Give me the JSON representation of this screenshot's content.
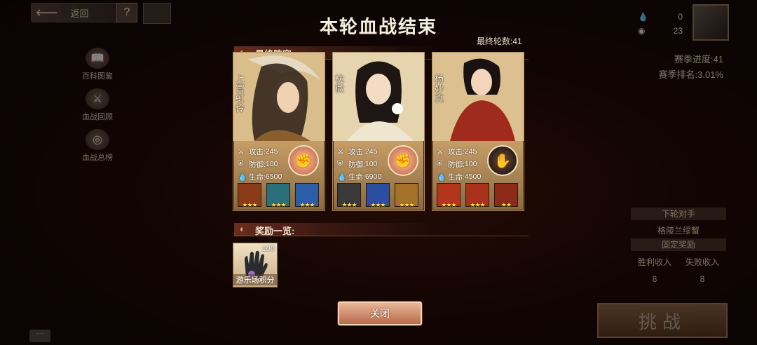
{
  "nav": {
    "back_label": "返回",
    "help_label": "?"
  },
  "side_menu": [
    {
      "label": "百科图鉴",
      "icon": "book-icon"
    },
    {
      "label": "血战回顾",
      "icon": "replay-icon"
    },
    {
      "label": "血战总榜",
      "icon": "ranking-icon"
    }
  ],
  "currency": {
    "top_value": "0",
    "bottom_value": "23"
  },
  "season": {
    "progress": "赛季进度:41",
    "rank": "赛季排名:3.01%"
  },
  "right_panel": {
    "next_opponent_header": "下轮对手",
    "opponent_name": "格陵兰缪蟹",
    "fixed_reward_header": "固定奖励",
    "win_income_label": "胜利收入",
    "lose_income_label": "失败收入",
    "win_value": "8",
    "lose_value": "8",
    "challenge_label": "挑战"
  },
  "modal": {
    "title": "本轮血战结束",
    "rounds": "最终轮数:41",
    "lineup_label": "最终阵容",
    "rewards_label": "奖励一览:",
    "close_label": "关闭"
  },
  "heroes": [
    {
      "name": "上官虹伶",
      "attack_label": "攻击:",
      "attack": "245",
      "defense_label": "防御:",
      "defense": "100",
      "hp_label": "生命:",
      "hp": "6500",
      "stars": [
        "★★★",
        "★★★",
        "★★★"
      ],
      "skill_colors": [
        "#8a3b1a",
        "#2b6f7a",
        "#2a5ea8"
      ]
    },
    {
      "name": "枕微",
      "attack_label": "攻击:",
      "attack": "245",
      "defense_label": "防御:",
      "defense": "100",
      "hp_label": "生命:",
      "hp": "6900",
      "stars": [
        "★★★",
        "★★★",
        "★★★"
      ],
      "skill_colors": [
        "#3a3a3a",
        "#2a4fa0",
        "#a4702a"
      ]
    },
    {
      "name": "杨妙真",
      "attack_label": "攻击:",
      "attack": "245",
      "defense_label": "防御:",
      "defense": "100",
      "hp_label": "生命:",
      "hp": "4500",
      "stars": [
        "★★★",
        "★★★",
        "★★"
      ],
      "skill_colors": [
        "#b3361c",
        "#a8321a",
        "#8e2a18"
      ]
    }
  ],
  "reward": {
    "count": "100",
    "name": "游乐场积分"
  },
  "chat": {
    "label": "···"
  }
}
